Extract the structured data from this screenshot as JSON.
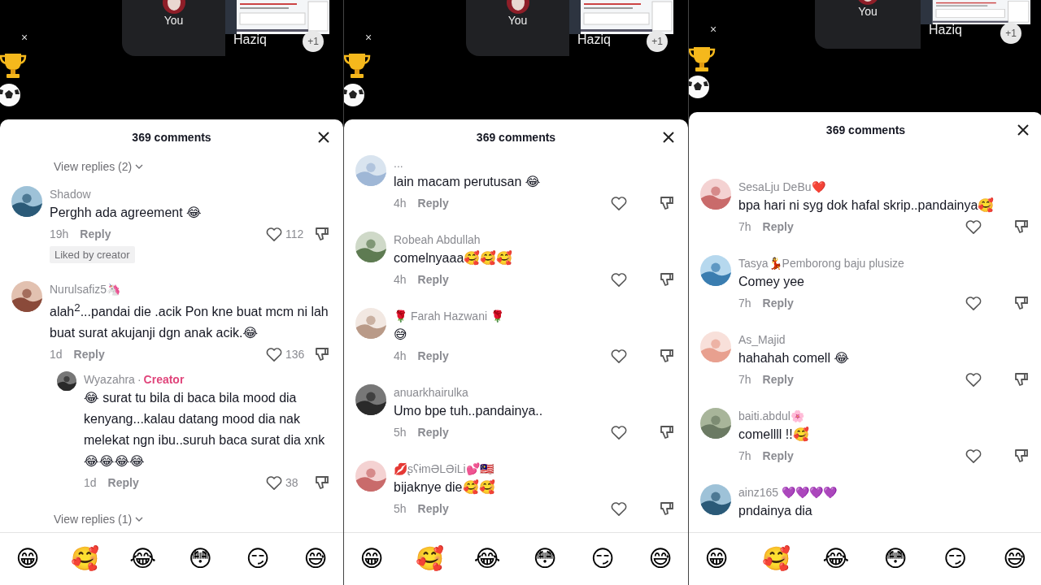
{
  "panels": [
    {
      "call": {
        "self_label": "You",
        "share_label": "Haziq",
        "extra_count": "+1",
        "dismiss": "×"
      },
      "sheet": {
        "title": "369 comments",
        "items": [
          {
            "kind": "view_replies",
            "label": "View replies (2)"
          },
          {
            "kind": "comment",
            "author": "Shadow",
            "text": "Perghh ada agreement 😂",
            "time": "19h",
            "reply": "Reply",
            "likes": "112",
            "tag": "Liked by creator"
          },
          {
            "kind": "comment",
            "author": "Nurulsafiz5🦄",
            "text": "alah$^{2}$...pandai die .acik Pon kne buat mcm ni lah buat surat akujanji dgn anak acik.😂",
            "time": "1d",
            "reply": "Reply",
            "likes": "136",
            "replies": [
              {
                "author": "Wyazahra",
                "separator": "·",
                "badge": "Creator",
                "text": "😂 surat tu bila di baca bila mood dia kenyang...kalau datang mood dia nak melekat ngn ibu..suruh baca surat dia xnk😂😂😂😂",
                "time": "1d",
                "reply": "Reply",
                "likes": "38"
              }
            ]
          },
          {
            "kind": "view_replies",
            "label": "View replies (1)"
          }
        ]
      },
      "quick_emojis": [
        "😁",
        "🥰",
        "😂",
        "😳",
        "😏",
        "😅"
      ]
    },
    {
      "call": {
        "self_label": "You",
        "share_label": "Haziq",
        "extra_count": "+1",
        "dismiss": "×"
      },
      "sheet": {
        "title": "369 comments",
        "items": [
          {
            "kind": "comment",
            "author": "...",
            "text": "lain macam perutusan 😂",
            "time": "4h",
            "reply": "Reply"
          },
          {
            "kind": "comment",
            "author": "Robeah Abdullah",
            "text": "comelnyaaa🥰🥰🥰",
            "time": "4h",
            "reply": "Reply"
          },
          {
            "kind": "comment",
            "author": "🌹 Farah Hazwani 🌹",
            "text": "😅",
            "time": "4h",
            "reply": "Reply"
          },
          {
            "kind": "comment",
            "author": "anuarkhairulka",
            "text": "Umo bpe tuh..pandainya..",
            "time": "5h",
            "reply": "Reply"
          },
          {
            "kind": "comment",
            "author": "💋ʂʕɨmƏLƏiLi💕🇲🇾",
            "text": "bijaknye die🥰🥰",
            "time": "5h",
            "reply": "Reply"
          }
        ]
      },
      "quick_emojis": [
        "😁",
        "🥰",
        "😂",
        "😳",
        "😏",
        "😅"
      ]
    },
    {
      "call": {
        "self_label": "You",
        "share_label": "Haziq",
        "extra_count": "+1",
        "dismiss": "×"
      },
      "sheet": {
        "title": "369 comments",
        "items": [
          {
            "kind": "comment",
            "author": "SesaLju DeBu❤️",
            "text": "bpa hari ni syg dok hafal skrip..pandainya🥰",
            "time": "7h",
            "reply": "Reply"
          },
          {
            "kind": "comment",
            "author": "Tasya💃Pemborong baju plusize",
            "text": "Comey yee",
            "time": "7h",
            "reply": "Reply"
          },
          {
            "kind": "comment",
            "author": "As_Majid",
            "text": "hahahah comell 😂",
            "time": "7h",
            "reply": "Reply"
          },
          {
            "kind": "comment",
            "author": "baiti.abdul🌸",
            "text": "comellll !!🥰",
            "time": "7h",
            "reply": "Reply"
          },
          {
            "kind": "comment",
            "author": "ainz165 💜💜💜💜",
            "text": "pndainya dia"
          }
        ]
      },
      "quick_emojis": [
        "😁",
        "🥰",
        "😂",
        "😳",
        "😏",
        "😅"
      ]
    }
  ]
}
